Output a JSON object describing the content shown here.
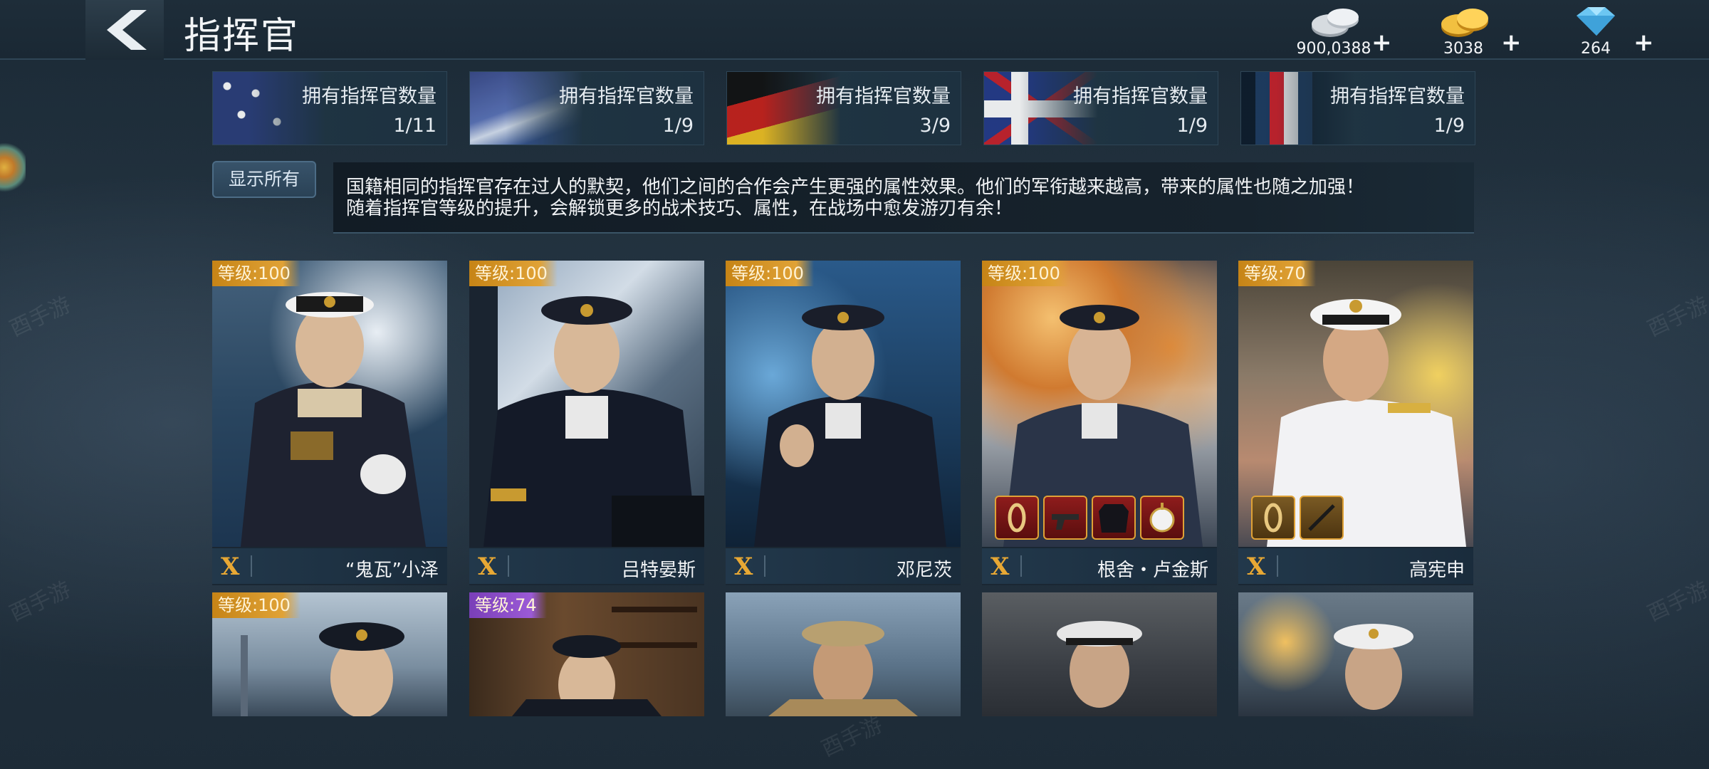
{
  "header": {
    "title": "指挥官",
    "silver": "900,0388",
    "gold": "3038",
    "diamond": "264",
    "plus": "+"
  },
  "nations": [
    {
      "label": "拥有指挥官数量",
      "count": "1/11",
      "flag": "usa"
    },
    {
      "label": "拥有指挥官数量",
      "count": "1/9",
      "flag": "japan"
    },
    {
      "label": "拥有指挥官数量",
      "count": "3/9",
      "flag": "germany"
    },
    {
      "label": "拥有指挥官数量",
      "count": "1/9",
      "flag": "uk"
    },
    {
      "label": "拥有指挥官数量",
      "count": "1/9",
      "flag": "ussr"
    }
  ],
  "filter": {
    "show_all": "显示所有"
  },
  "description": {
    "line1": "国籍相同的指挥官存在过人的默契，他们之间的合作会产生更强的属性效果。他们的军衔越来越高，带来的属性也随之加强！",
    "line2": "随着指挥官等级的提升，会解锁更多的战术技巧、属性，在战场中愈发游刃有余！"
  },
  "commanders_row1": [
    {
      "level": "等级:100",
      "rank": "X",
      "name": "“鬼瓦”小泽",
      "uniform": "dark",
      "cap": "white"
    },
    {
      "level": "等级:100",
      "rank": "X",
      "name": "吕特晏斯",
      "uniform": "dark",
      "cap": "dark"
    },
    {
      "level": "等级:100",
      "rank": "X",
      "name": "邓尼茨",
      "uniform": "dark",
      "cap": "dark"
    },
    {
      "level": "等级:100",
      "rank": "X",
      "name": "根舍・卢金斯",
      "uniform": "dark",
      "cap": "dark",
      "equip": [
        "rope-icon",
        "pistol-icon",
        "jacket-icon",
        "pocket-watch-icon"
      ]
    },
    {
      "level": "等级:70",
      "rank": "X",
      "name": "高宪申",
      "uniform": "white",
      "cap": "white",
      "equip": [
        "rope-icon",
        "baton-icon"
      ]
    }
  ],
  "commanders_row2": [
    {
      "level": "等级:100",
      "level_color": "gold"
    },
    {
      "level": "等级:74",
      "level_color": "purple"
    },
    {
      "level": ""
    },
    {
      "level": ""
    },
    {
      "level": ""
    }
  ],
  "watermark": "酉手游"
}
